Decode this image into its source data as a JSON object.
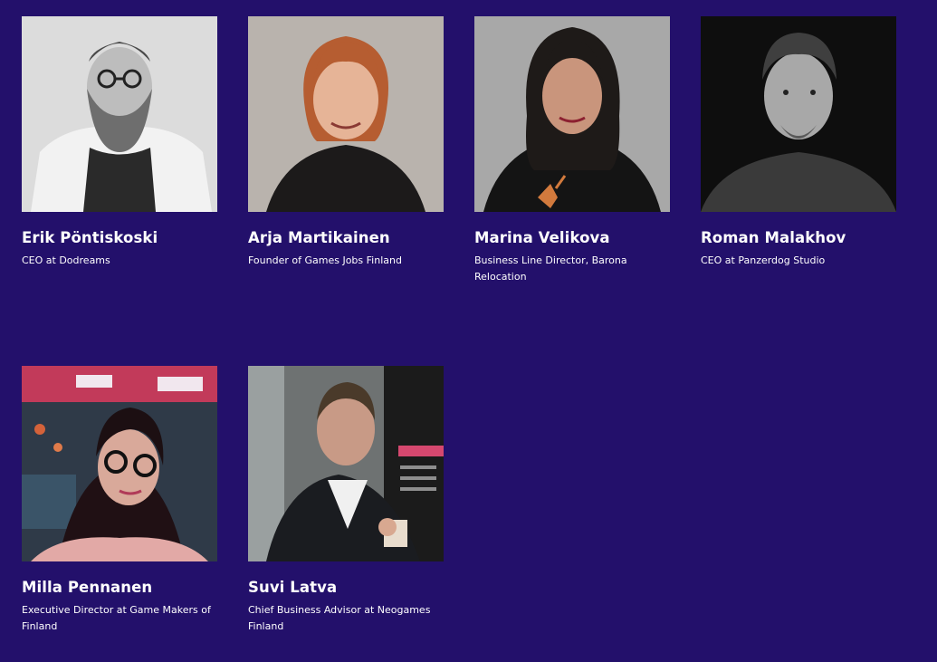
{
  "speakers": [
    {
      "name": "Erik Pöntiskoski",
      "role": "CEO at Dodreams"
    },
    {
      "name": "Arja Martikainen",
      "role": "Founder of Games Jobs Finland"
    },
    {
      "name": "Marina Velikova",
      "role": "Business Line Director, Barona Relocation"
    },
    {
      "name": "Roman Malakhov",
      "role": "CEO at Panzerdog Studio"
    },
    {
      "name": "Milla Pennanen",
      "role": "Executive Director at Game Makers of Finland"
    },
    {
      "name": "Suvi Latva",
      "role": "Chief Business Advisor at Neogames Finland"
    }
  ],
  "colors": {
    "background": "#23106b",
    "text": "#ffffff"
  }
}
